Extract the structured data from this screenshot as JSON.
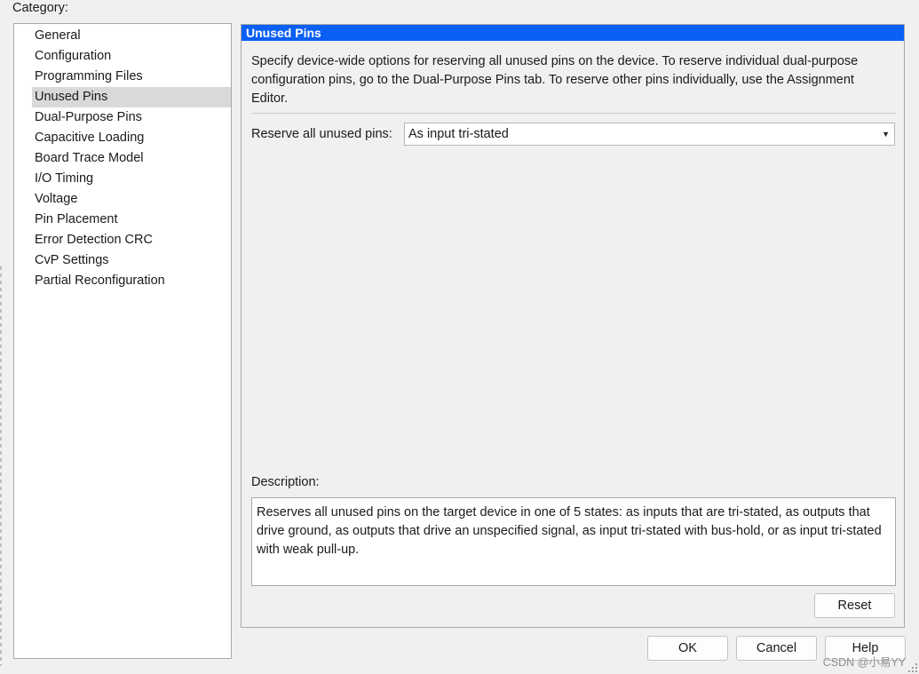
{
  "category": {
    "label": "Category:",
    "items": [
      {
        "label": "General"
      },
      {
        "label": "Configuration"
      },
      {
        "label": "Programming Files"
      },
      {
        "label": "Unused Pins",
        "selected": true
      },
      {
        "label": "Dual-Purpose Pins"
      },
      {
        "label": "Capacitive Loading"
      },
      {
        "label": "Board Trace Model"
      },
      {
        "label": "I/O Timing"
      },
      {
        "label": "Voltage"
      },
      {
        "label": "Pin Placement"
      },
      {
        "label": "Error Detection CRC"
      },
      {
        "label": "CvP Settings"
      },
      {
        "label": "Partial Reconfiguration"
      }
    ]
  },
  "panel": {
    "title": "Unused Pins",
    "intro": "Specify device-wide options for reserving all unused pins on the device. To reserve individual dual-purpose configuration pins, go to the Dual-Purpose Pins tab. To reserve other pins individually, use the Assignment Editor.",
    "reserve_label": "Reserve all unused pins:",
    "reserve_value": "As input tri-stated",
    "description_label": "Description:",
    "description_text": "Reserves all unused pins on the target device in one of 5 states: as inputs that are tri-stated, as outputs that drive ground, as outputs that drive an unspecified signal, as input tri-stated with bus-hold, or as input tri-stated with weak pull-up.",
    "reset_label": "Reset"
  },
  "buttons": {
    "ok": "OK",
    "cancel": "Cancel",
    "help": "Help"
  },
  "watermark": "CSDN @小易YY",
  "colors": {
    "header_bg": "#0a5ff5",
    "selected_bg": "#d9d9d9"
  }
}
